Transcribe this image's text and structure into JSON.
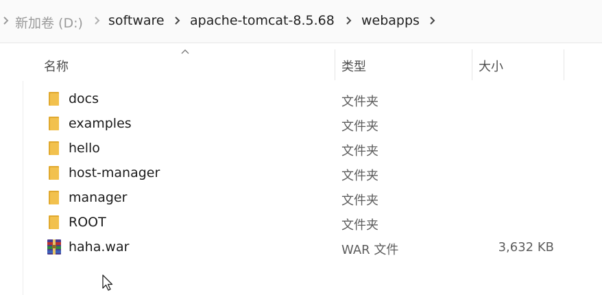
{
  "breadcrumb": {
    "items": [
      {
        "label": "新加卷 (D:)"
      },
      {
        "label": "software"
      },
      {
        "label": "apache-tomcat-8.5.68"
      },
      {
        "label": "webapps"
      }
    ]
  },
  "columns": {
    "name": "名称",
    "type": "类型",
    "size": "大小"
  },
  "files": [
    {
      "name": "docs",
      "type": "文件夹",
      "size": "",
      "icon": "folder-icon"
    },
    {
      "name": "examples",
      "type": "文件夹",
      "size": "",
      "icon": "folder-icon"
    },
    {
      "name": "hello",
      "type": "文件夹",
      "size": "",
      "icon": "folder-icon"
    },
    {
      "name": "host-manager",
      "type": "文件夹",
      "size": "",
      "icon": "folder-icon"
    },
    {
      "name": "manager",
      "type": "文件夹",
      "size": "",
      "icon": "folder-icon"
    },
    {
      "name": "ROOT",
      "type": "文件夹",
      "size": "",
      "icon": "folder-icon"
    },
    {
      "name": "haha.war",
      "type": "WAR 文件",
      "size": "3,632 KB",
      "icon": "archive-icon"
    }
  ],
  "colors": {
    "folder": "#f2c14e",
    "folder_dark": "#e0a82e",
    "header_text": "#4d4d4d",
    "type_text": "#5c5c5c"
  }
}
